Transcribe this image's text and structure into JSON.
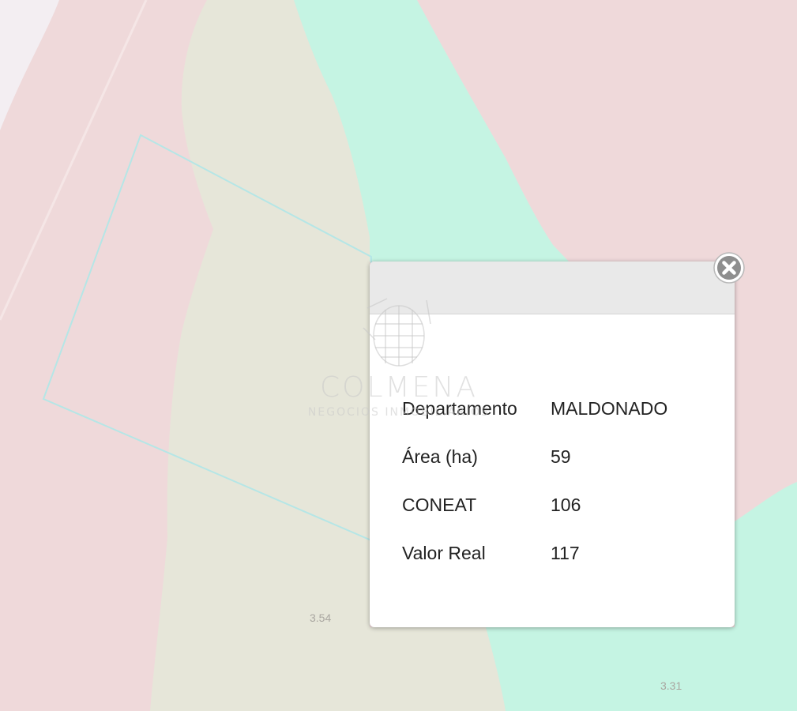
{
  "map": {
    "zone_labels": [
      "3.54",
      "3.31"
    ],
    "colors": {
      "pink_zone": "#efd9da",
      "beige_zone": "#e6e6d9",
      "mint_zone": "#c5f4e3",
      "parcel_outline": "#b5e6e6"
    }
  },
  "watermark": {
    "title": "COLMENA",
    "subtitle": "NEGOCIOS INMOBILIARIOS",
    "icon": "beehive-logo"
  },
  "popup": {
    "close_icon": "close-icon",
    "rows": [
      {
        "label": "Departamento",
        "value": "MALDONADO"
      },
      {
        "label": "Área (ha)",
        "value": "59"
      },
      {
        "label": "CONEAT",
        "value": "106"
      },
      {
        "label": "Valor Real",
        "value": "117"
      }
    ]
  }
}
